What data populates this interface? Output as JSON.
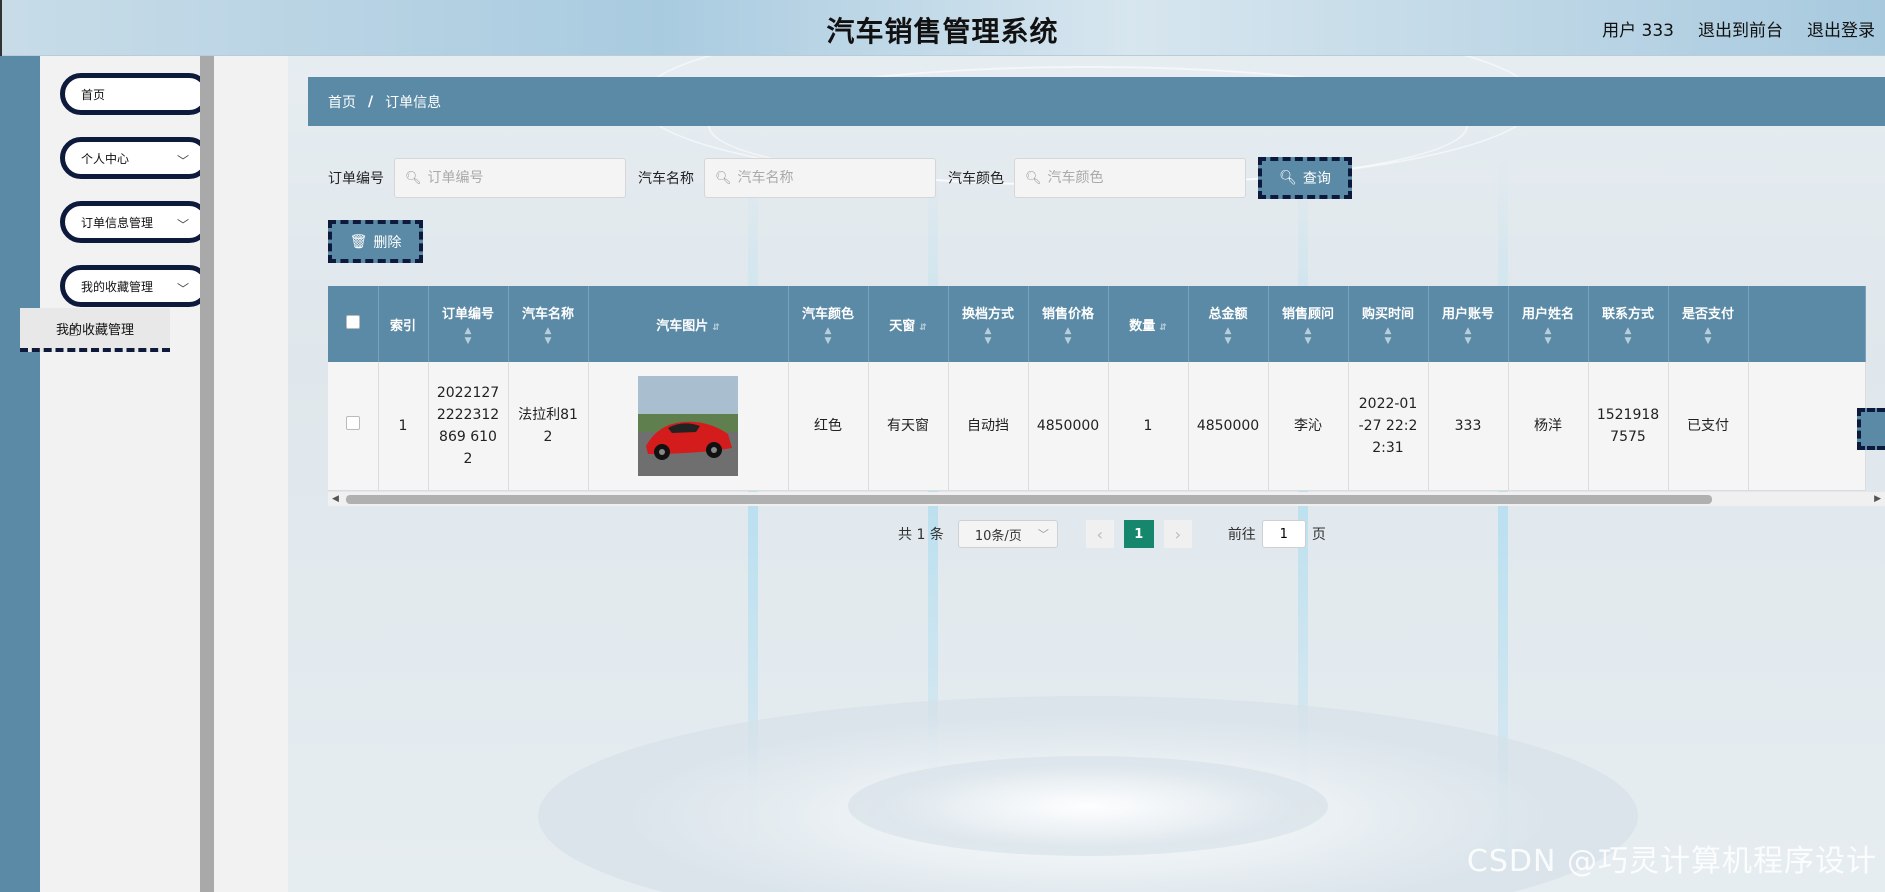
{
  "header": {
    "title": "汽车销售管理系统",
    "user_label": "用户 333",
    "back_to_front": "退出到前台",
    "logout": "退出登录"
  },
  "sidebar": {
    "items": [
      {
        "label": "首页"
      },
      {
        "label": "个人中心"
      },
      {
        "label": "订单信息管理"
      },
      {
        "label": "我的收藏管理"
      }
    ],
    "sub_item": "我的收藏管理"
  },
  "breadcrumb": {
    "home": "首页",
    "sep": "/",
    "current": "订单信息"
  },
  "search": {
    "order_no_label": "订单编号",
    "order_no_placeholder": "订单编号",
    "car_name_label": "汽车名称",
    "car_name_placeholder": "汽车名称",
    "car_color_label": "汽车颜色",
    "car_color_placeholder": "汽车颜色",
    "query_button": "查询"
  },
  "actions": {
    "delete_button": "删除"
  },
  "table": {
    "columns": [
      "索引",
      "订单编号",
      "汽车名称",
      "汽车图片",
      "汽车颜色",
      "天窗",
      "换档方式",
      "销售价格",
      "数量",
      "总金额",
      "销售顾问",
      "购买时间",
      "用户账号",
      "用户姓名",
      "联系方式",
      "是否支付"
    ],
    "rows": [
      {
        "index": "1",
        "order_no": "20221272222312869 6102",
        "car_name": "法拉利812",
        "car_color": "红色",
        "sunroof": "有天窗",
        "gearbox": "自动挡",
        "price": "4850000",
        "quantity": "1",
        "total": "4850000",
        "consultant": "李沁",
        "buy_time": "2022-01-27 22:22:31",
        "account": "333",
        "user_name": "杨洋",
        "phone": "15219187575",
        "paid": "已支付"
      }
    ]
  },
  "pagination": {
    "total_text": "共 1 条",
    "page_size": "10条/页",
    "current_page": "1",
    "goto_label": "前往",
    "goto_value": "1",
    "page_unit": "页"
  },
  "watermark": "CSDN @巧灵计算机程序设计",
  "colors": {
    "accent": "#5b8aa6",
    "border_dark": "#0e1a3c",
    "page_active": "#16876d"
  }
}
